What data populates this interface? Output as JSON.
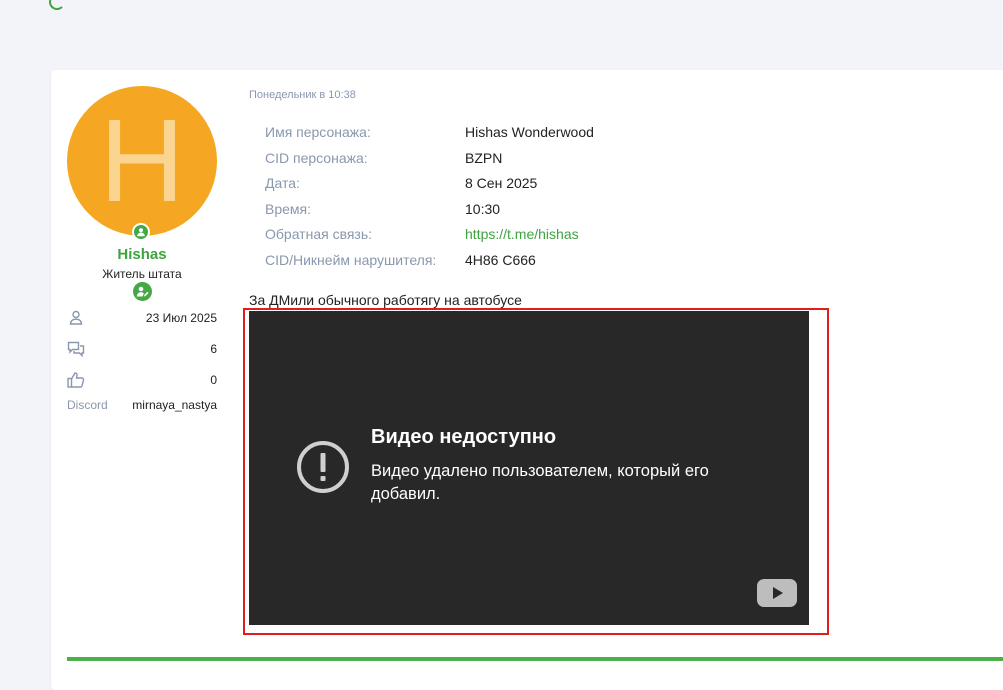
{
  "user": {
    "avatar_letter": "H",
    "name": "Hishas",
    "title": "Житель штата",
    "stats": {
      "joined": "23 Июл 2025",
      "messages": "6",
      "reactions": "0",
      "discord_label": "Discord",
      "discord_value": "mirnaya_nastya"
    }
  },
  "post": {
    "date": "Понедельник в 10:38",
    "fields": [
      {
        "key": "Имя персонажа:",
        "value": "Hishas Wonderwood"
      },
      {
        "key": "CID персонажа:",
        "value": "BZPN"
      },
      {
        "key": "Дата:",
        "value": "8 Сен 2025"
      },
      {
        "key": "Время:",
        "value": "10:30"
      },
      {
        "key": "Обратная связь:",
        "value": "https://t.me/hishas"
      },
      {
        "key": "CID/Никнейм нарушителя:",
        "value": "4H86 C666"
      }
    ],
    "text": "За ДМили обычного работягу на автобусе"
  },
  "video": {
    "title": "Видео недоступно",
    "message": "Видео удалено пользователем, который его добавил."
  },
  "colors": {
    "accent_green": "#3fa33f",
    "avatar_bg": "#f5a623",
    "video_bg": "#282828",
    "highlight_border": "#e01e1e"
  }
}
